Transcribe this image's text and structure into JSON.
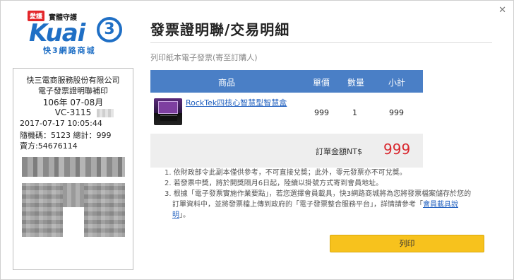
{
  "close_label": "✕",
  "logo": {
    "badge": "愛護",
    "tagline": "實體守護",
    "brand": "Kuai",
    "brand_number": "3",
    "chinese_name": "快3網路商城"
  },
  "receipt": {
    "company": "快三電商服務股份有限公司",
    "title": "電子發票證明聯補印",
    "period": "106年 07-08月",
    "invoice_code": "VC-3115",
    "datetime": "2017-07-17 10:05:44",
    "random_and_total": "隨機碼：5123    總計：999",
    "seller": "賣方:54676114"
  },
  "modal": {
    "title": "發票證明聯/交易明細",
    "subtitle": "列印紙本電子發票(寄至訂購人)"
  },
  "table": {
    "headers": {
      "product": "商品",
      "unit_price": "單價",
      "quantity": "數量",
      "subtotal": "小計"
    },
    "rows": [
      {
        "product_name": "RockTek四核心智慧型智慧盒",
        "unit_price": "999",
        "quantity": "1",
        "subtotal": "999"
      }
    ],
    "total_label": "訂單金額NT$",
    "total_value": "999"
  },
  "notes": {
    "n1": "1. 依財政部令此副本僅供參考，不可直接兌獎；此外，零元發票亦不可兌獎。",
    "n2": "2. 若發票中獎，將於開獎隔月6日起，陸續以掛號方式寄到會員地址。",
    "n3_a": "3. 根據「電子發票實施作業要點」，若您選擇會員載具，快3網路商城將為您將發票檔案儲存於您的",
    "n3_b": "訂單資料中，並將發票檔上傳到政府的「電子發票整合服務平台」，詳情請參考「",
    "n3_link_a": "會員載具說",
    "n3_link_b": "明",
    "n3_end": "」。"
  },
  "buttons": {
    "print": "列印"
  },
  "colors": {
    "header_blue": "#4a7fc6",
    "print_yellow": "#f7c21d",
    "total_red": "#d9282f"
  }
}
